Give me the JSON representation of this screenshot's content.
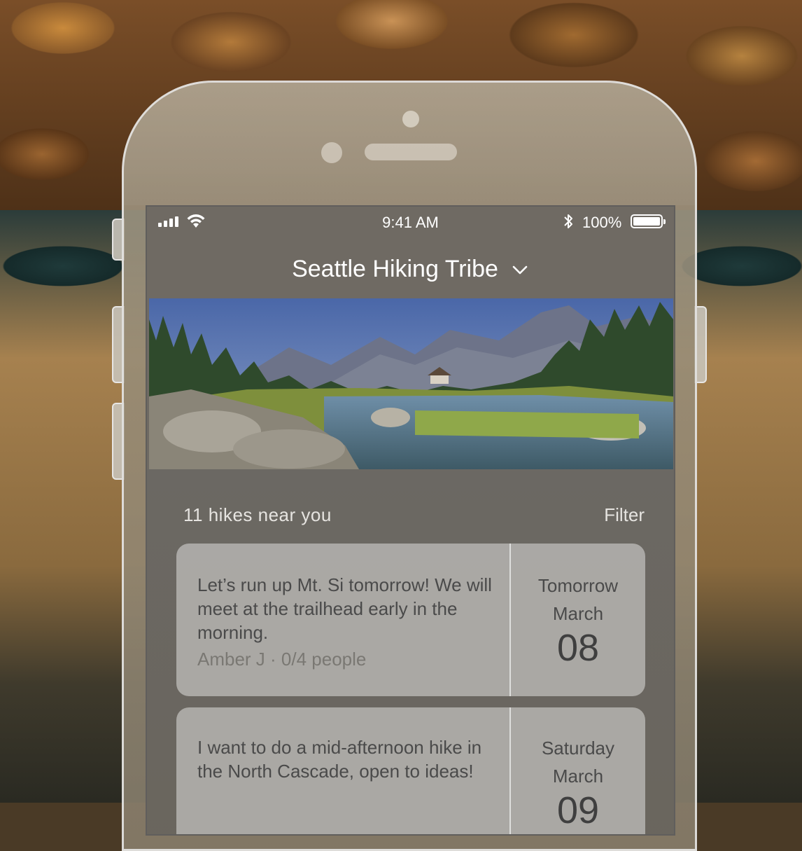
{
  "status_bar": {
    "time": "9:41 AM",
    "battery_percent": "100%",
    "battery_level": 1.0,
    "signal_icon": "cellular-signal-icon",
    "wifi_icon": "wifi-icon",
    "bluetooth_icon": "bluetooth-icon"
  },
  "nav": {
    "title": "Seattle Hiking Tribe",
    "dropdown_icon": "chevron-down-icon"
  },
  "hero": {
    "image": "mountain-lake-landscape"
  },
  "list": {
    "count_label": "11 hikes near you",
    "filter_label": "Filter"
  },
  "hikes": [
    {
      "description": "Let’s run up Mt. Si tomorrow! We will meet at the trailhead early in the morning.",
      "meta": "Amber J · 0/4 people",
      "day": "Tomorrow",
      "month": "March",
      "date": "08"
    },
    {
      "description": "I want to do a mid-afternoon hike in the North Cascade, open to ideas!",
      "meta": "",
      "day": "Saturday",
      "month": "March",
      "date": "09"
    }
  ],
  "colors": {
    "text_light": "#ffffff",
    "card_background": "#b0aeaa",
    "card_text": "#4a4a4a",
    "meta_text": "#7a7873"
  }
}
